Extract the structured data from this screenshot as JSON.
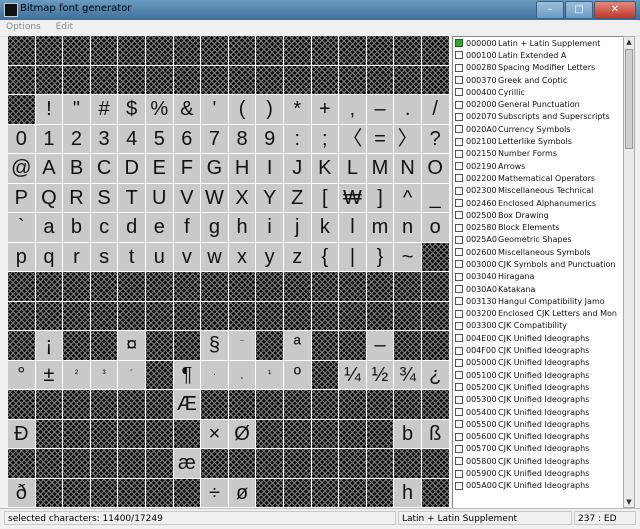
{
  "window": {
    "title": "Bitmap font generator",
    "icon": "bitmap-font-app-icon"
  },
  "titlebar_buttons": {
    "minimize": "–",
    "maximize": "□",
    "close": "✕"
  },
  "menu": {
    "items": [
      "Options",
      "Edit"
    ]
  },
  "grid": {
    "rows": [
      [
        "",
        "",
        "",
        "",
        "",
        "",
        "",
        "",
        "",
        "",
        "",
        "",
        "",
        "",
        "",
        ""
      ],
      [
        "",
        "",
        "",
        "",
        "",
        "",
        "",
        "",
        "",
        "",
        "",
        "",
        "",
        "",
        "",
        ""
      ],
      [
        "",
        "!",
        "\"",
        "#",
        "$",
        "%",
        "&",
        "'",
        "(",
        ")",
        "*",
        "+",
        ",",
        "–",
        ".",
        "/"
      ],
      [
        "0",
        "1",
        "2",
        "3",
        "4",
        "5",
        "6",
        "7",
        "8",
        "9",
        ":",
        ";",
        "〈",
        "=",
        "〉",
        "?"
      ],
      [
        "@",
        "A",
        "B",
        "C",
        "D",
        "E",
        "F",
        "G",
        "H",
        "I",
        "J",
        "K",
        "L",
        "M",
        "N",
        "O"
      ],
      [
        "P",
        "Q",
        "R",
        "S",
        "T",
        "U",
        "V",
        "W",
        "X",
        "Y",
        "Z",
        "[",
        "₩",
        "]",
        "^",
        "_"
      ],
      [
        "`",
        "a",
        "b",
        "c",
        "d",
        "e",
        "f",
        "g",
        "h",
        "i",
        "j",
        "k",
        "l",
        "m",
        "n",
        "o"
      ],
      [
        "p",
        "q",
        "r",
        "s",
        "t",
        "u",
        "v",
        "w",
        "x",
        "y",
        "z",
        "{",
        "|",
        "}",
        "~",
        ""
      ],
      [
        "",
        "",
        "",
        "",
        "",
        "",
        "",
        "",
        "",
        "",
        "",
        "",
        "",
        "",
        "",
        ""
      ],
      [
        "",
        "",
        "",
        "",
        "",
        "",
        "",
        "",
        "",
        "",
        "",
        "",
        "",
        "",
        "",
        ""
      ],
      [
        "",
        "¡",
        "",
        "",
        "¤",
        "",
        "",
        "§",
        "¨",
        "",
        "ª",
        "",
        "",
        "–",
        "",
        ""
      ],
      [
        "°",
        "±",
        "²",
        "³",
        "´",
        "",
        "¶",
        "·",
        "¸",
        "¹",
        "º",
        "",
        "¼",
        "½",
        "¾",
        "¿"
      ],
      [
        "",
        "",
        "",
        "",
        "",
        "",
        "Æ",
        "",
        "",
        "",
        "",
        "",
        "",
        "",
        "",
        ""
      ],
      [
        "Ð",
        "",
        "",
        "",
        "",
        "",
        "",
        "×",
        "Ø",
        "",
        "",
        "",
        "",
        "",
        "b",
        "ß"
      ],
      [
        "",
        "",
        "",
        "",
        "",
        "",
        "æ",
        "",
        "",
        "",
        "",
        "",
        "",
        "",
        "",
        ""
      ],
      [
        "ð",
        "",
        "",
        "",
        "",
        "",
        "",
        "÷",
        "ø",
        "",
        "",
        "",
        "",
        "",
        "h",
        ""
      ]
    ],
    "small_glyphs": [
      "²",
      "³",
      "´",
      "¨",
      "¸",
      "¹",
      "·"
    ]
  },
  "unicode_ranges": [
    {
      "code": "000000",
      "name": "Latin + Latin Supplement",
      "checked": true
    },
    {
      "code": "000100",
      "name": "Latin Extended A",
      "checked": false
    },
    {
      "code": "000280",
      "name": "Spacing Modifier Letters",
      "checked": false
    },
    {
      "code": "000370",
      "name": "Greek and Coptic",
      "checked": false
    },
    {
      "code": "000400",
      "name": "Cyrillic",
      "checked": false
    },
    {
      "code": "002000",
      "name": "General Punctuation",
      "checked": false
    },
    {
      "code": "002070",
      "name": "Subscripts and Superscripts",
      "checked": false
    },
    {
      "code": "0020A0",
      "name": "Currency Symbols",
      "checked": false
    },
    {
      "code": "002100",
      "name": "Letterlike Symbols",
      "checked": false
    },
    {
      "code": "002150",
      "name": "Number Forms",
      "checked": false
    },
    {
      "code": "002190",
      "name": "Arrows",
      "checked": false
    },
    {
      "code": "002200",
      "name": "Mathematical Operators",
      "checked": false
    },
    {
      "code": "002300",
      "name": "Miscellaneous Technical",
      "checked": false
    },
    {
      "code": "002460",
      "name": "Enclosed Alphanumerics",
      "checked": false
    },
    {
      "code": "002500",
      "name": "Box Drawing",
      "checked": false
    },
    {
      "code": "002580",
      "name": "Block Elements",
      "checked": false
    },
    {
      "code": "0025A0",
      "name": "Geometric Shapes",
      "checked": false
    },
    {
      "code": "002600",
      "name": "Miscellaneous Symbols",
      "checked": false
    },
    {
      "code": "003000",
      "name": "CJK Symbols and Punctuation",
      "checked": false
    },
    {
      "code": "003040",
      "name": "Hiragana",
      "checked": false
    },
    {
      "code": "0030A0",
      "name": "Katakana",
      "checked": false
    },
    {
      "code": "003130",
      "name": "Hangul Compatibility Jamo",
      "checked": false
    },
    {
      "code": "003200",
      "name": "Enclosed CJK Letters and Mon",
      "checked": false
    },
    {
      "code": "003300",
      "name": "CJK Compatibility",
      "checked": false
    },
    {
      "code": "004E00",
      "name": "CJK Unified Ideographs",
      "checked": false
    },
    {
      "code": "004F00",
      "name": "CJK Unified Ideographs",
      "checked": false
    },
    {
      "code": "005000",
      "name": "CJK Unified Ideographs",
      "checked": false
    },
    {
      "code": "005100",
      "name": "CJK Unified Ideographs",
      "checked": false
    },
    {
      "code": "005200",
      "name": "CJK Unified Ideographs",
      "checked": false
    },
    {
      "code": "005300",
      "name": "CJK Unified Ideographs",
      "checked": false
    },
    {
      "code": "005400",
      "name": "CJK Unified Ideographs",
      "checked": false
    },
    {
      "code": "005500",
      "name": "CJK Unified Ideographs",
      "checked": false
    },
    {
      "code": "005600",
      "name": "CJK Unified Ideographs",
      "checked": false
    },
    {
      "code": "005700",
      "name": "CJK Unified Ideographs",
      "checked": false
    },
    {
      "code": "005800",
      "name": "CJK Unified Ideographs",
      "checked": false
    },
    {
      "code": "005900",
      "name": "CJK Unified Ideographs",
      "checked": false
    },
    {
      "code": "005A00",
      "name": "CJK Unified Ideographs",
      "checked": false
    }
  ],
  "status": {
    "selected": "selected characters: 11400/17249",
    "range": "Latin + Latin Supplement",
    "char": "237 : ED"
  },
  "colors": {
    "titlebar": "#4a7aa6",
    "checked": "#2ea82e",
    "glyph_cell": "#c9c9c9",
    "empty_cell": "#111111"
  }
}
